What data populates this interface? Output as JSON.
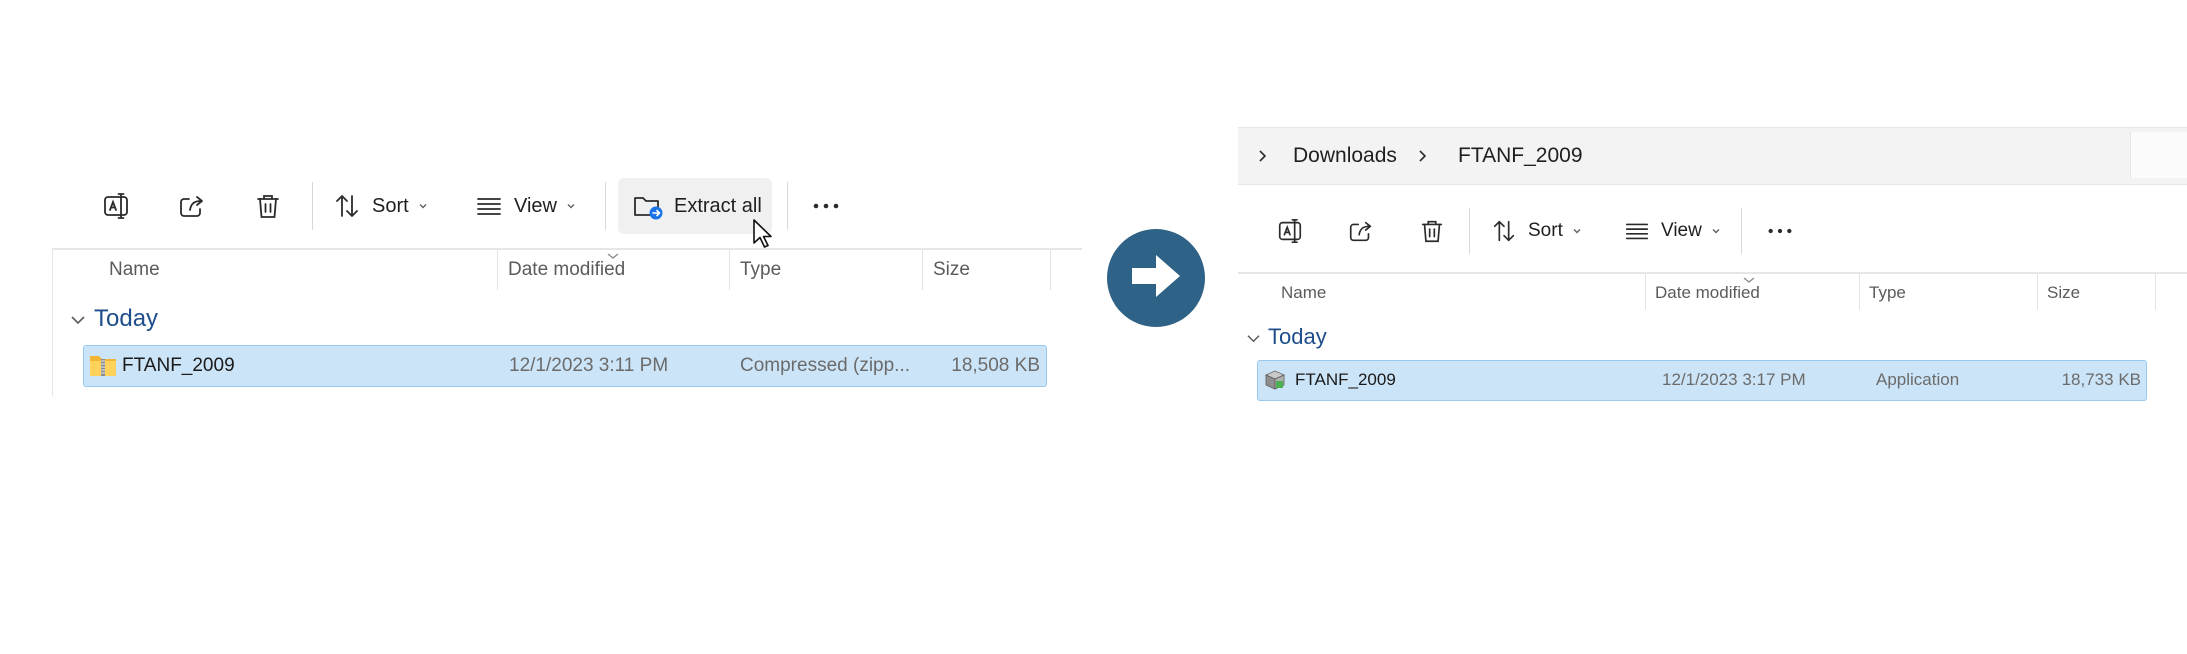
{
  "left": {
    "toolbar": {
      "sort_label": "Sort",
      "view_label": "View",
      "extract_label": "Extract all"
    },
    "columns": {
      "name": "Name",
      "date": "Date modified",
      "type": "Type",
      "size": "Size"
    },
    "group_label": "Today",
    "file": {
      "name": "FTANF_2009",
      "date": "12/1/2023 3:11 PM",
      "type": "Compressed (zipp...",
      "size": "18,508 KB",
      "icon": "zip-folder-icon"
    }
  },
  "arrow": {
    "icon": "arrow-right-icon",
    "color": "#2e6286"
  },
  "right": {
    "breadcrumb": {
      "item1": "Downloads",
      "item2": "FTANF_2009"
    },
    "toolbar": {
      "sort_label": "Sort",
      "view_label": "View"
    },
    "columns": {
      "name": "Name",
      "date": "Date modified",
      "type": "Type",
      "size": "Size"
    },
    "group_label": "Today",
    "file": {
      "name": "FTANF_2009",
      "date": "12/1/2023 3:17 PM",
      "type": "Application",
      "size": "18,733 KB",
      "icon": "application-icon"
    }
  },
  "colors": {
    "selection": "#cce4f7",
    "group_text": "#1f4e8c"
  }
}
